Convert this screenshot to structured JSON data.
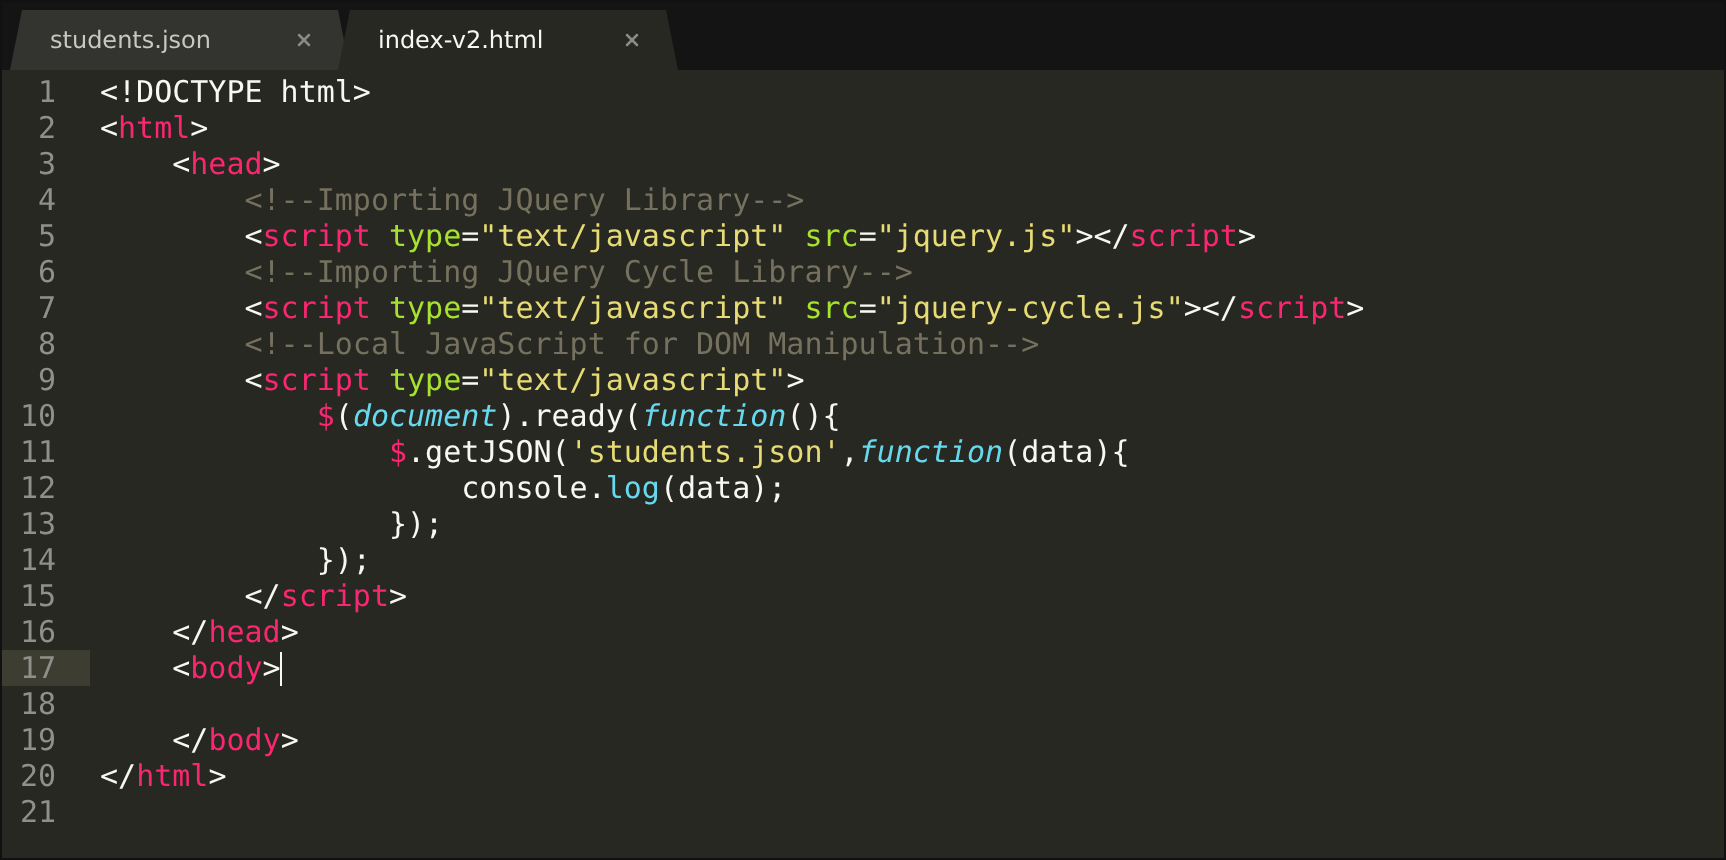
{
  "tabs": [
    {
      "label": "students.json",
      "selected": false
    },
    {
      "label": "index-v2.html",
      "selected": true
    }
  ],
  "lines": [
    {
      "number": "1",
      "current": false,
      "tokens": [
        {
          "kind": "punct",
          "text": "<!DOCTYPE html>"
        }
      ]
    },
    {
      "number": "2",
      "current": false,
      "tokens": [
        {
          "kind": "punct",
          "text": "<"
        },
        {
          "kind": "tag",
          "text": "html"
        },
        {
          "kind": "punct",
          "text": ">"
        }
      ]
    },
    {
      "number": "3",
      "current": false,
      "tokens": [
        {
          "kind": "punct",
          "text": "    <"
        },
        {
          "kind": "tag",
          "text": "head"
        },
        {
          "kind": "punct",
          "text": ">"
        }
      ]
    },
    {
      "number": "4",
      "current": false,
      "tokens": [
        {
          "kind": "comment",
          "text": "        <!--Importing JQuery Library-->"
        }
      ]
    },
    {
      "number": "5",
      "current": false,
      "tokens": [
        {
          "kind": "punct",
          "text": "        <"
        },
        {
          "kind": "tag",
          "text": "script"
        },
        {
          "kind": "attr",
          "text": " type"
        },
        {
          "kind": "punct",
          "text": "="
        },
        {
          "kind": "string",
          "text": "\"text/javascript\""
        },
        {
          "kind": "attr",
          "text": " src"
        },
        {
          "kind": "punct",
          "text": "="
        },
        {
          "kind": "string",
          "text": "\"jquery.js\""
        },
        {
          "kind": "punct",
          "text": "></"
        },
        {
          "kind": "tag",
          "text": "script"
        },
        {
          "kind": "punct",
          "text": ">"
        }
      ]
    },
    {
      "number": "6",
      "current": false,
      "tokens": [
        {
          "kind": "comment",
          "text": "        <!--Importing JQuery Cycle Library-->"
        }
      ]
    },
    {
      "number": "7",
      "current": false,
      "tokens": [
        {
          "kind": "punct",
          "text": "        <"
        },
        {
          "kind": "tag",
          "text": "script"
        },
        {
          "kind": "attr",
          "text": " type"
        },
        {
          "kind": "punct",
          "text": "="
        },
        {
          "kind": "string",
          "text": "\"text/javascript\""
        },
        {
          "kind": "attr",
          "text": " src"
        },
        {
          "kind": "punct",
          "text": "="
        },
        {
          "kind": "string",
          "text": "\"jquery-cycle.js\""
        },
        {
          "kind": "punct",
          "text": "></"
        },
        {
          "kind": "tag",
          "text": "script"
        },
        {
          "kind": "punct",
          "text": ">"
        }
      ]
    },
    {
      "number": "8",
      "current": false,
      "tokens": [
        {
          "kind": "comment",
          "text": "        <!--Local JavaScript for DOM Manipulation-->"
        }
      ]
    },
    {
      "number": "9",
      "current": false,
      "tokens": [
        {
          "kind": "punct",
          "text": "        <"
        },
        {
          "kind": "tag",
          "text": "script"
        },
        {
          "kind": "attr",
          "text": " type"
        },
        {
          "kind": "punct",
          "text": "="
        },
        {
          "kind": "string",
          "text": "\"text/javascript\""
        },
        {
          "kind": "punct",
          "text": ">"
        }
      ]
    },
    {
      "number": "10",
      "current": false,
      "tokens": [
        {
          "kind": "tag",
          "text": "            $"
        },
        {
          "kind": "punct",
          "text": "("
        },
        {
          "kind": "italic",
          "text": "document"
        },
        {
          "kind": "punct",
          "text": ").ready("
        },
        {
          "kind": "italic",
          "text": "function"
        },
        {
          "kind": "punct",
          "text": "(){"
        }
      ]
    },
    {
      "number": "11",
      "current": false,
      "tokens": [
        {
          "kind": "tag",
          "text": "                $"
        },
        {
          "kind": "punct",
          "text": ".getJSON("
        },
        {
          "kind": "string",
          "text": "'students.json'"
        },
        {
          "kind": "punct",
          "text": ","
        },
        {
          "kind": "italic",
          "text": "function"
        },
        {
          "kind": "punct",
          "text": "(data){"
        }
      ]
    },
    {
      "number": "12",
      "current": false,
      "tokens": [
        {
          "kind": "punct",
          "text": "                    console."
        },
        {
          "kind": "support",
          "text": "log"
        },
        {
          "kind": "punct",
          "text": "(data);"
        }
      ]
    },
    {
      "number": "13",
      "current": false,
      "tokens": [
        {
          "kind": "punct",
          "text": "                });"
        }
      ]
    },
    {
      "number": "14",
      "current": false,
      "tokens": [
        {
          "kind": "punct",
          "text": "            });"
        }
      ]
    },
    {
      "number": "15",
      "current": false,
      "tokens": [
        {
          "kind": "punct",
          "text": "        </"
        },
        {
          "kind": "tag",
          "text": "script"
        },
        {
          "kind": "punct",
          "text": ">"
        }
      ]
    },
    {
      "number": "16",
      "current": false,
      "tokens": [
        {
          "kind": "punct",
          "text": "    </"
        },
        {
          "kind": "tag",
          "text": "head"
        },
        {
          "kind": "punct",
          "text": ">"
        }
      ]
    },
    {
      "number": "17",
      "current": true,
      "tokens": [
        {
          "kind": "punct",
          "text": "    <"
        },
        {
          "kind": "tag",
          "text": "body"
        },
        {
          "kind": "punct",
          "text": ">"
        }
      ]
    },
    {
      "number": "18",
      "current": false
    },
    {
      "number": "19",
      "current": false,
      "tokens": [
        {
          "kind": "punct",
          "text": "    </"
        },
        {
          "kind": "tag",
          "text": "body"
        },
        {
          "kind": "punct",
          "text": ">"
        }
      ]
    },
    {
      "number": "20",
      "current": false,
      "tokens": [
        {
          "kind": "punct",
          "text": "</"
        },
        {
          "kind": "tag",
          "text": "html"
        },
        {
          "kind": "punct",
          "text": ">"
        }
      ]
    },
    {
      "number": "21",
      "current": false
    }
  ]
}
